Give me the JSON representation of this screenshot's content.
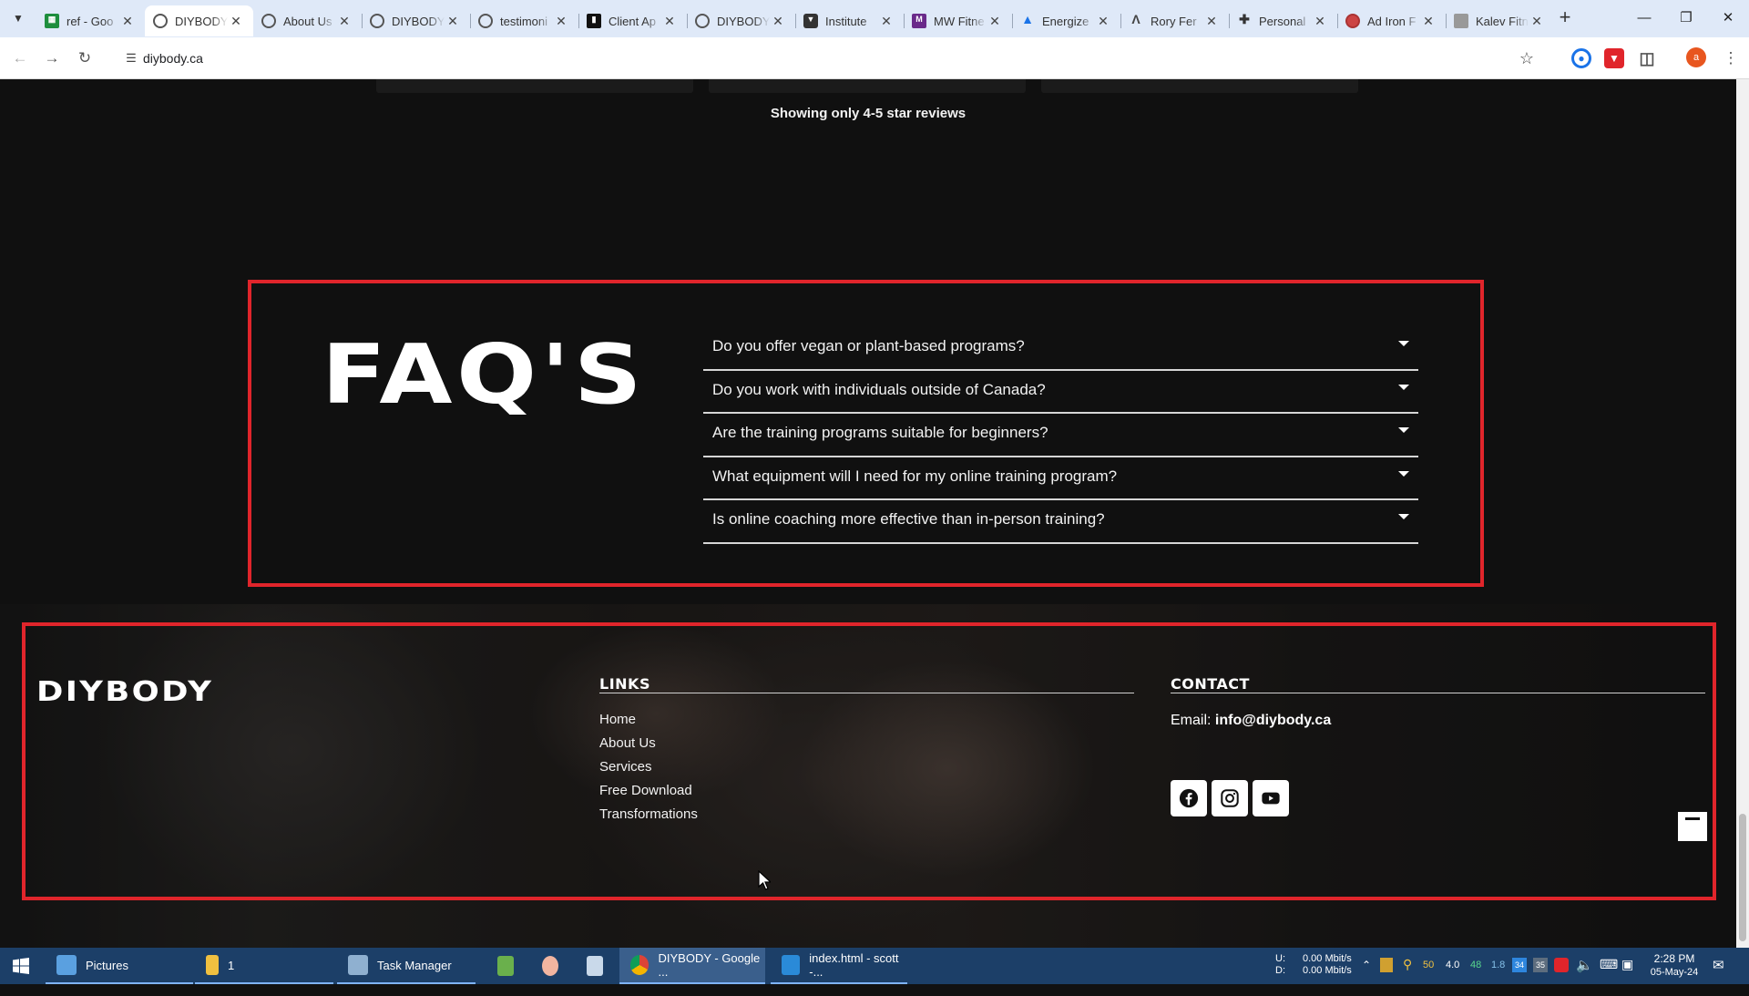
{
  "browser": {
    "tabs": [
      {
        "title": "ref - Goo",
        "icon": "sheets-icon"
      },
      {
        "title": "DIYBODY",
        "icon": "globe-icon",
        "active": true
      },
      {
        "title": "About Us",
        "icon": "globe-icon"
      },
      {
        "title": "DIYBODY",
        "icon": "globe-icon"
      },
      {
        "title": "testimoni",
        "icon": "globe-icon"
      },
      {
        "title": "Client Ap",
        "icon": "app-icon"
      },
      {
        "title": "DIYBODY",
        "icon": "globe-icon"
      },
      {
        "title": "Institute",
        "icon": "shield-icon"
      },
      {
        "title": "MW Fitne",
        "icon": "mw-icon"
      },
      {
        "title": "Energize",
        "icon": "energize-icon"
      },
      {
        "title": "Rory Fer",
        "icon": "rory-icon"
      },
      {
        "title": "Personal",
        "icon": "personal-icon"
      },
      {
        "title": "Ad Iron F",
        "icon": "iron-icon"
      },
      {
        "title": "Kalev Fitn",
        "icon": "kalev-icon"
      }
    ],
    "url": "diybody.ca",
    "profile_initial": "a"
  },
  "page": {
    "reviews_note": "Showing only 4-5 star reviews",
    "faq": {
      "title": "FAQ'S",
      "questions": [
        "Do you offer vegan or plant-based programs?",
        "Do you work with individuals outside of Canada?",
        "Are the training programs suitable for beginners?",
        "What equipment will I need for my online training program?",
        "Is online coaching more effective than in-person training?"
      ]
    },
    "footer": {
      "logo": "DIYBODY",
      "links_heading": "LINKS",
      "links": [
        "Home",
        "About Us",
        "Services",
        "Free Download",
        "Transformations"
      ],
      "contact_heading": "CONTACT",
      "email_label": "Email:",
      "email": "info@diybody.ca",
      "social": [
        "facebook-icon",
        "instagram-icon",
        "youtube-icon"
      ]
    }
  },
  "taskbar": {
    "apps": [
      {
        "label": "Pictures"
      },
      {
        "label": "1"
      },
      {
        "label": "Task Manager"
      },
      {
        "label": ""
      },
      {
        "label": ""
      },
      {
        "label": ""
      },
      {
        "label": "DIYBODY - Google ..."
      },
      {
        "label": "index.html - scott -..."
      }
    ],
    "net_up_label": "U:",
    "net_down_label": "D:",
    "net_up": "0.00 Mbit/s",
    "net_down": "0.00 Mbit/s",
    "tray_numbers": [
      "50",
      "4.0",
      "48",
      "1.8"
    ],
    "tray_badges": [
      "34",
      "35"
    ],
    "time": "2:28 PM",
    "date": "05-May-24"
  },
  "colors": {
    "highlight": "#e0252b",
    "tabstrip": "#dfe9f8",
    "taskbar": "#1c3f68"
  }
}
